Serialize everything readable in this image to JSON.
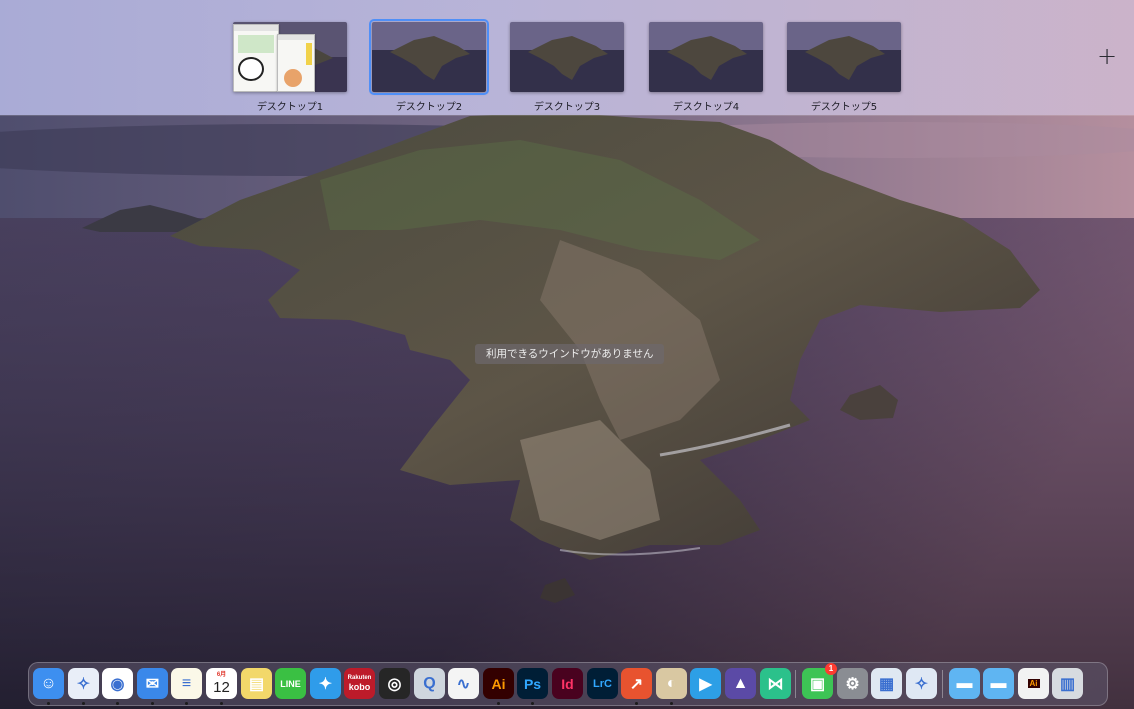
{
  "spaces": [
    {
      "label": "デスクトップ1",
      "active": false,
      "has_windows": true
    },
    {
      "label": "デスクトップ2",
      "active": true,
      "has_windows": false
    },
    {
      "label": "デスクトップ3",
      "active": false,
      "has_windows": false
    },
    {
      "label": "デスクトップ4",
      "active": false,
      "has_windows": false
    },
    {
      "label": "デスクトップ5",
      "active": false,
      "has_windows": false
    }
  ],
  "add_space_symbol": "+",
  "message": "利用できるウインドウがありません",
  "dock": {
    "apps": [
      {
        "name": "finder",
        "icon": "finder-icon",
        "text": "",
        "bg": "#3d8ff0",
        "running": true
      },
      {
        "name": "safari",
        "icon": "safari-icon",
        "text": "",
        "bg": "#e9eef8",
        "running": true
      },
      {
        "name": "chrome",
        "icon": "chrome-icon",
        "text": "",
        "bg": "#ffffff",
        "running": true
      },
      {
        "name": "mail",
        "icon": "mail-icon",
        "text": "",
        "bg": "#3a88ea",
        "running": true
      },
      {
        "name": "notes",
        "icon": "notes-icon",
        "text": "",
        "bg": "#fbf8e8",
        "running": true
      },
      {
        "name": "calendar",
        "icon": "calendar-icon",
        "text": "12",
        "subtext": "6月",
        "bg": "#ffffff",
        "running": true
      },
      {
        "name": "stickies",
        "icon": "stickies-icon",
        "text": "",
        "bg": "#f2d86a",
        "running": false
      },
      {
        "name": "line",
        "icon": "line-icon",
        "text": "LINE",
        "bg": "#3ac043",
        "running": false
      },
      {
        "name": "twitter",
        "icon": "twitter-icon",
        "text": "",
        "bg": "#2f9cea",
        "running": false
      },
      {
        "name": "kobo",
        "icon": "kobo-icon",
        "text": "kobo",
        "subtext": "Rakuten",
        "bg": "#bd1b2a",
        "running": false
      },
      {
        "name": "obs",
        "icon": "obs-icon",
        "text": "",
        "bg": "#262626",
        "running": false
      },
      {
        "name": "quicktime",
        "icon": "quicktime-icon",
        "text": "",
        "bg": "#cfd6de",
        "running": false
      },
      {
        "name": "clip-studio",
        "icon": "clip-studio-icon",
        "text": "",
        "bg": "#f4f4f4",
        "running": false
      },
      {
        "name": "illustrator",
        "icon": "illustrator-icon",
        "text": "Ai",
        "bg": "#330000",
        "fg": "#ff9a00",
        "running": true
      },
      {
        "name": "photoshop",
        "icon": "photoshop-icon",
        "text": "Ps",
        "bg": "#001e36",
        "fg": "#31a8ff",
        "running": true
      },
      {
        "name": "indesign",
        "icon": "indesign-icon",
        "text": "Id",
        "bg": "#49021f",
        "fg": "#ff3366",
        "running": false
      },
      {
        "name": "lightroom-classic",
        "icon": "lightroom-icon",
        "text": "LrC",
        "bg": "#001e36",
        "fg": "#31a8ff",
        "running": false
      },
      {
        "name": "stocks-app",
        "icon": "chart-arrow-icon",
        "text": "",
        "bg": "#e8532f",
        "running": true
      },
      {
        "name": "podcast-mic",
        "icon": "microphone-icon",
        "text": "",
        "bg": "#d9c8a2",
        "running": true
      },
      {
        "name": "video-player",
        "icon": "play-icon",
        "text": "",
        "bg": "#2d9fe6",
        "running": false
      },
      {
        "name": "rocket-app",
        "icon": "rocket-icon",
        "text": "",
        "bg": "#5b4aa6",
        "running": false
      },
      {
        "name": "code-app",
        "icon": "code-icon",
        "text": "",
        "bg": "#2bc18b",
        "running": false
      }
    ],
    "utilities": [
      {
        "name": "facetime",
        "icon": "facetime-icon",
        "text": "",
        "bg": "#3dc455",
        "running": false,
        "badge": "1"
      },
      {
        "name": "system-preferences",
        "icon": "gear-icon",
        "text": "",
        "bg": "#8a8d93",
        "running": false
      },
      {
        "name": "preview",
        "icon": "preview-icon",
        "text": "",
        "bg": "#dfe8f2",
        "running": false
      },
      {
        "name": "safari-webapp",
        "icon": "safari-icon",
        "text": "",
        "bg": "#dfe8f4",
        "running": false
      }
    ],
    "stacks": [
      {
        "name": "folder-applications",
        "icon": "folder-icon",
        "bg": "#5fb5f2"
      },
      {
        "name": "folder-downloads",
        "icon": "folder-icon",
        "bg": "#5fb5f2"
      },
      {
        "name": "file-ai",
        "icon": "document-icon",
        "text": "Ai",
        "bg": "#f2f2f2"
      },
      {
        "name": "trash",
        "icon": "trash-icon",
        "bg": "#d7dbe0"
      }
    ]
  }
}
